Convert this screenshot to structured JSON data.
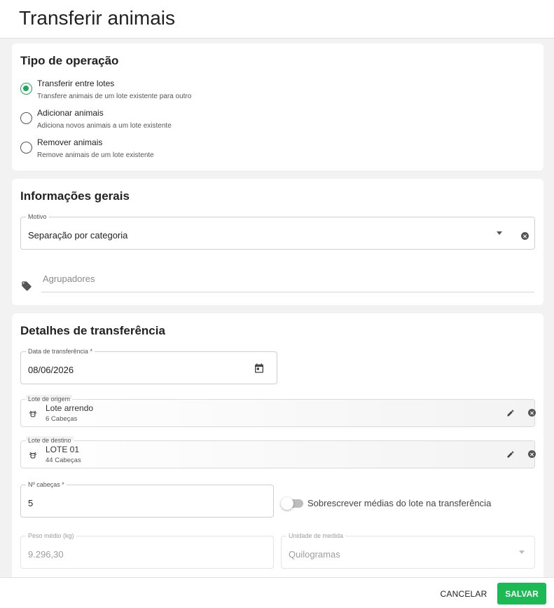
{
  "page": {
    "title": "Transferir animais"
  },
  "tipo_operacao": {
    "heading": "Tipo de operação",
    "options": [
      {
        "label": "Transferir entre lotes",
        "description": "Transfere animais de um lote existente para outro",
        "selected": true
      },
      {
        "label": "Adicionar animais",
        "description": "Adiciona novos animais a um lote existente",
        "selected": false
      },
      {
        "label": "Remover animais",
        "description": "Remove animais de um lote existente",
        "selected": false
      }
    ]
  },
  "informacoes_gerais": {
    "heading": "Informações gerais",
    "motivo": {
      "label": "Motivo",
      "value": "Separação por categoria"
    },
    "agrupadores": {
      "placeholder": "Agrupadores"
    }
  },
  "detalhes": {
    "heading": "Detalhes de transferência",
    "data": {
      "label": "Data de transferência *",
      "value": "08/06/2026"
    },
    "lote_origem": {
      "label": "Lote de origem",
      "name": "Lote arrendo",
      "count": "6 Cabeças"
    },
    "lote_destino": {
      "label": "Lote de destino",
      "name": "LOTE 01",
      "count": "44 Cabeças"
    },
    "cabecas": {
      "label": "Nº cabeças *",
      "value": "5"
    },
    "toggle": {
      "label": "Sobrescrever médias do lote na transferência",
      "checked": false
    },
    "peso_medio": {
      "label": "Peso médio (kg)",
      "value": "9.296,30"
    },
    "unidade": {
      "label": "Unidade de medida",
      "value": "Quilogramas"
    }
  },
  "footer": {
    "cancel_label": "CANCELAR",
    "save_label": "SALVAR"
  },
  "colors": {
    "accent": "#1db954",
    "radio_selected": "#1ea75a"
  }
}
